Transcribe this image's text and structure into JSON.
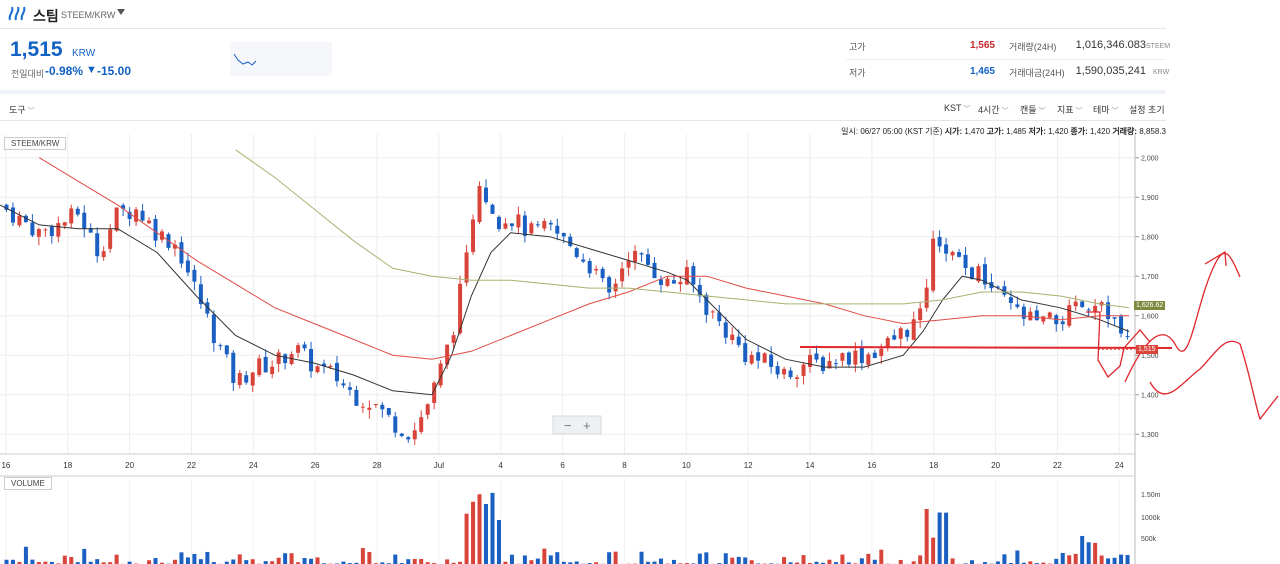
{
  "header": {
    "coin_name": "스팀",
    "pair": "STEEM/KRW"
  },
  "price": {
    "value": "1,515",
    "unit": "KRW",
    "change_label": "전일대비",
    "change_rate": "-0.98%",
    "change_arrow": "▼",
    "change_amount": "-15.00"
  },
  "stats": {
    "high_label": "고가",
    "high_value": "1,565",
    "low_label": "저가",
    "low_value": "1,465",
    "volume_label": "거래량(24H)",
    "volume_value": "1,016,346.083",
    "volume_unit": "STEEM",
    "amount_label": "거래대금(24H)",
    "amount_value": "1,590,035,241",
    "amount_unit": "KRW"
  },
  "toolbar": {
    "tools": "도구",
    "timezone": "KST",
    "interval": "4시간",
    "candle": "캔들",
    "indicator": "지표",
    "theme": "테마",
    "reset": "설정 초기"
  },
  "info": {
    "datetime_label": "일시:",
    "datetime": "06/27 05:00 (KST 기준)",
    "open_label": "시가:",
    "open": "1,470",
    "high_label": "고가:",
    "high": "1,485",
    "low_label": "저가:",
    "low": "1,420",
    "close_label": "종가:",
    "close": "1,420",
    "volume_label": "거래량:",
    "volume": "8,858.3"
  },
  "chart_labels": {
    "symbol": "STEEM/KRW",
    "volume": "VOLUME",
    "price_tag_current": "1,515",
    "price_tag_ma": "1,626.62",
    "zoom_out": "−",
    "zoom_in": "+"
  },
  "colors": {
    "up": "#d9443a",
    "down": "#1a5fc2",
    "accent": "#1261c4",
    "high": "#c8282d"
  },
  "chart_data": {
    "type": "line",
    "title": "",
    "xlabel": "",
    "ylabel": "",
    "x_ticks": [
      "16",
      "18",
      "20",
      "22",
      "24",
      "26",
      "28",
      "Jul",
      "4",
      "6",
      "8",
      "10",
      "12",
      "14",
      "16",
      "18",
      "20",
      "22",
      "24"
    ],
    "y_ticks": [
      "2,000",
      "1,900",
      "1,800",
      "1,700",
      "1,600",
      "1,500",
      "1,400",
      "1,300"
    ],
    "ylim": [
      1250,
      2060
    ],
    "volume_ticks": [
      "1.50m",
      "1000k",
      "500k"
    ],
    "price_series": [
      [
        0,
        1880
      ],
      [
        2,
        1810
      ],
      [
        3,
        1830
      ],
      [
        4,
        1860
      ],
      [
        5,
        1760
      ],
      [
        6,
        1860
      ],
      [
        7,
        1870
      ],
      [
        8,
        1810
      ],
      [
        9,
        1780
      ],
      [
        10,
        1660
      ],
      [
        11,
        1540
      ],
      [
        12,
        1430
      ],
      [
        13,
        1470
      ],
      [
        14,
        1480
      ],
      [
        15,
        1520
      ],
      [
        16,
        1470
      ],
      [
        17,
        1450
      ],
      [
        18,
        1400
      ],
      [
        19,
        1380
      ],
      [
        20,
        1330
      ],
      [
        21,
        1300
      ],
      [
        22,
        1400
      ],
      [
        23,
        1550
      ],
      [
        24,
        1800
      ],
      [
        24.5,
        1960
      ],
      [
        25,
        1840
      ],
      [
        26,
        1850
      ],
      [
        27,
        1810
      ],
      [
        28,
        1820
      ],
      [
        29,
        1780
      ],
      [
        30,
        1730
      ],
      [
        31,
        1650
      ],
      [
        32,
        1760
      ],
      [
        33,
        1730
      ],
      [
        34,
        1680
      ],
      [
        35,
        1700
      ],
      [
        36,
        1620
      ],
      [
        37,
        1560
      ],
      [
        38,
        1500
      ],
      [
        39,
        1480
      ],
      [
        40,
        1450
      ],
      [
        41,
        1480
      ],
      [
        42,
        1480
      ],
      [
        43,
        1500
      ],
      [
        44,
        1500
      ],
      [
        45,
        1520
      ],
      [
        46,
        1560
      ],
      [
        47,
        1600
      ],
      [
        47.5,
        1820
      ],
      [
        48,
        1780
      ],
      [
        49,
        1720
      ],
      [
        50,
        1700
      ],
      [
        51,
        1640
      ],
      [
        52,
        1600
      ],
      [
        53,
        1580
      ],
      [
        54,
        1590
      ],
      [
        55,
        1620
      ],
      [
        56,
        1650
      ],
      [
        57,
        1560
      ],
      [
        57.5,
        1520
      ]
    ],
    "series": [
      {
        "name": "MA (black)",
        "values": [
          [
            0,
            1880
          ],
          [
            2,
            1830
          ],
          [
            4,
            1820
          ],
          [
            6,
            1820
          ],
          [
            8,
            1760
          ],
          [
            10,
            1650
          ],
          [
            12,
            1550
          ],
          [
            14,
            1500
          ],
          [
            16,
            1480
          ],
          [
            18,
            1450
          ],
          [
            20,
            1410
          ],
          [
            22,
            1400
          ],
          [
            23,
            1500
          ],
          [
            24,
            1650
          ],
          [
            25,
            1760
          ],
          [
            26,
            1810
          ],
          [
            28,
            1800
          ],
          [
            30,
            1770
          ],
          [
            32,
            1740
          ],
          [
            34,
            1710
          ],
          [
            35,
            1690
          ],
          [
            36,
            1640
          ],
          [
            38,
            1540
          ],
          [
            40,
            1490
          ],
          [
            42,
            1470
          ],
          [
            44,
            1470
          ],
          [
            46,
            1500
          ],
          [
            47,
            1560
          ],
          [
            48,
            1640
          ],
          [
            49,
            1700
          ],
          [
            50,
            1690
          ],
          [
            52,
            1640
          ],
          [
            54,
            1620
          ],
          [
            56,
            1590
          ],
          [
            57.5,
            1560
          ]
        ]
      },
      {
        "name": "MA (red)",
        "values": [
          [
            2,
            2000
          ],
          [
            4,
            1940
          ],
          [
            6,
            1880
          ],
          [
            8,
            1810
          ],
          [
            10,
            1740
          ],
          [
            12,
            1680
          ],
          [
            14,
            1620
          ],
          [
            16,
            1580
          ],
          [
            18,
            1540
          ],
          [
            20,
            1500
          ],
          [
            22,
            1490
          ],
          [
            24,
            1510
          ],
          [
            26,
            1550
          ],
          [
            28,
            1590
          ],
          [
            30,
            1630
          ],
          [
            32,
            1660
          ],
          [
            34,
            1700
          ],
          [
            36,
            1700
          ],
          [
            38,
            1670
          ],
          [
            40,
            1650
          ],
          [
            42,
            1630
          ],
          [
            44,
            1600
          ],
          [
            46,
            1580
          ],
          [
            48,
            1590
          ],
          [
            50,
            1600
          ],
          [
            52,
            1600
          ],
          [
            54,
            1590
          ],
          [
            56,
            1600
          ],
          [
            57.5,
            1600
          ]
        ]
      },
      {
        "name": "MA (olive)",
        "values": [
          [
            12,
            2020
          ],
          [
            14,
            1950
          ],
          [
            16,
            1870
          ],
          [
            18,
            1790
          ],
          [
            20,
            1720
          ],
          [
            22,
            1700
          ],
          [
            24,
            1690
          ],
          [
            26,
            1690
          ],
          [
            28,
            1680
          ],
          [
            30,
            1670
          ],
          [
            32,
            1670
          ],
          [
            34,
            1660
          ],
          [
            36,
            1650
          ],
          [
            38,
            1640
          ],
          [
            40,
            1630
          ],
          [
            42,
            1630
          ],
          [
            44,
            1630
          ],
          [
            46,
            1630
          ],
          [
            48,
            1640
          ],
          [
            50,
            1660
          ],
          [
            52,
            1660
          ],
          [
            54,
            1650
          ],
          [
            56,
            1630
          ],
          [
            57.5,
            1620
          ]
        ]
      }
    ]
  }
}
